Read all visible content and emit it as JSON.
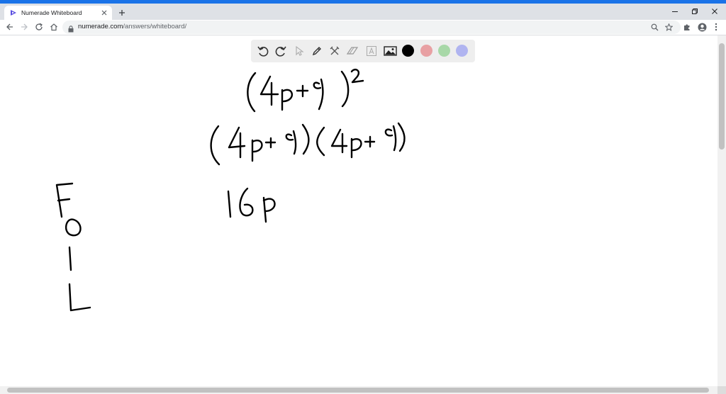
{
  "browser": {
    "tab": {
      "title": "Numerade Whiteboard",
      "favicon": "numerade-play-icon"
    },
    "url": {
      "domain": "numerade.com",
      "path": "/answers/whiteboard/"
    },
    "accent_color": "#1a73e8"
  },
  "whiteboard": {
    "tools": [
      "undo-icon",
      "redo-icon",
      "pointer-icon",
      "pen-icon",
      "tools-icon",
      "eraser-icon",
      "text-icon",
      "image-icon"
    ],
    "colors": [
      "#000000",
      "#e8a0a3",
      "#a8d8a8",
      "#b0b4f0"
    ],
    "handwriting": {
      "line1": "(4p+9)²",
      "line2": "(4p+9)(4p+9)",
      "line3": "16p",
      "foil_letters": [
        "F",
        "O",
        "I",
        "L"
      ]
    }
  }
}
